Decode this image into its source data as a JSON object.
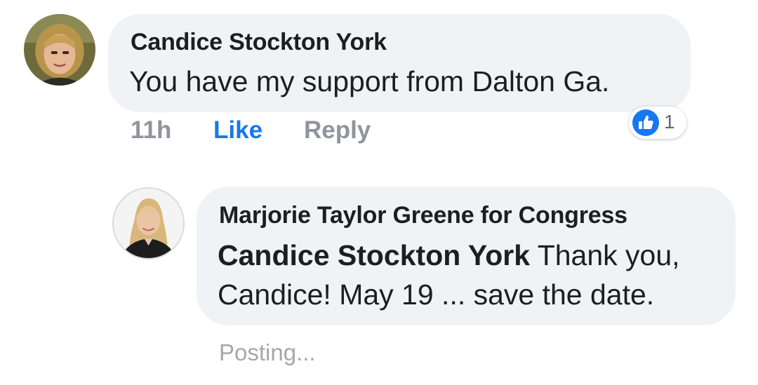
{
  "comment": {
    "author": "Candice Stockton York",
    "text": "You have my support from Dalton Ga.",
    "time": "11h",
    "like_label": "Like",
    "reply_label": "Reply",
    "reaction": {
      "icon": "thumbs-up-icon",
      "count": "1",
      "color": "#1877f2"
    }
  },
  "reply": {
    "author": "Marjorie Taylor Greene for Congress",
    "mention": "Candice Stockton York",
    "text_line1_rest": " Thank you,",
    "text_line2": "Candice! May 19 ... save the date.",
    "status": "Posting..."
  },
  "colors": {
    "bubble": "#f0f2f5",
    "link_blue": "#1877f2",
    "meta_gray": "#90949c"
  }
}
